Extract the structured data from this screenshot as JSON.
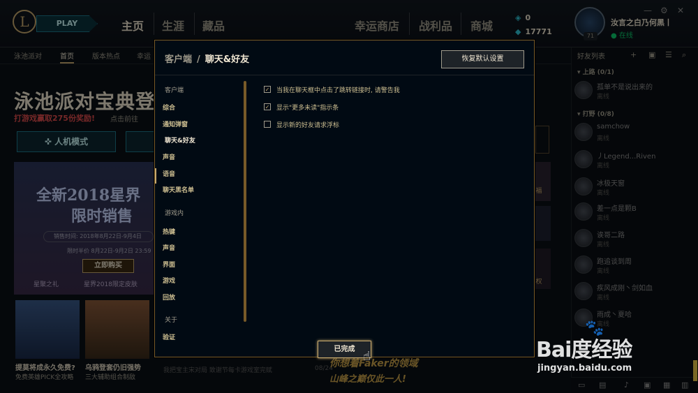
{
  "topbar": {
    "logo": "L",
    "play_label": "PLAY",
    "nav": [
      "主页",
      "生涯",
      "藏品",
      "幸运商店",
      "战利品",
      "商城"
    ],
    "currency": {
      "be": "0",
      "rp": "17771"
    },
    "currency_icons": [
      "blue-essence-icon",
      "riot-points-icon"
    ],
    "profile": {
      "name": "汝言之白乃何黑丨",
      "status": "在线",
      "level": "71"
    }
  },
  "subnav": [
    "泳池派对",
    "首页",
    "版本热点",
    "幸运"
  ],
  "background": {
    "headline": "泳池派对宝典登",
    "sub1": "打游戏赢取275份奖励!",
    "sub2": "点击前往",
    "btn1": "人机模式",
    "banner_title1": "全新2018星界",
    "banner_title2": "限时销售",
    "sale_time": "销售时间: 2018年8月22日-9月4日",
    "sale_time2": "限时半价 8月22日-9月2日 23:59",
    "buy": "立即购买",
    "tab1": "星聚之礼",
    "tab2": "星界2018限定皮肤",
    "cap1": "提莫将成永久免费?",
    "cap1b": "免费英雄PICK全攻略",
    "cap2": "乌鸦登套仍旧强势",
    "cap2b": "三大辅助组合制敌",
    "right_label1": "福",
    "right_label2": "权",
    "bottom_text": "我把宝主宋对局 致谢节每卡游戏室完赋",
    "bottom_date": "08/24",
    "bottom_banner1": "你想着Faker的领域",
    "bottom_banner2": "山峰之巅仅此一人!"
  },
  "friends": {
    "title": "好友列表",
    "groups": [
      {
        "label": "上路 (0/1)"
      },
      {
        "label": "打野 (0/8)"
      }
    ],
    "list": [
      {
        "name": "孤单不是说出来的",
        "status": "离线"
      },
      {
        "name": "samchow",
        "status": "离线"
      },
      {
        "name": "丿Legend...Riven",
        "status": "离线"
      },
      {
        "name": "冰极天窗",
        "status": "离线"
      },
      {
        "name": "差一点是颗B",
        "status": "离线"
      },
      {
        "name": "诶哥二路",
        "status": "离线"
      },
      {
        "name": "跑追谈到周",
        "status": "离线"
      },
      {
        "name": "疾风成刚丶剑如血",
        "status": "离线"
      },
      {
        "name": "雨成丶夏哈",
        "status": "离线"
      }
    ]
  },
  "modal": {
    "breadcrumb_root": "客户端",
    "breadcrumb_sep": "/",
    "breadcrumb_current": "聊天&好友",
    "reset_label": "恢复默认设置",
    "done_label": "已完成",
    "sections": [
      {
        "title": "客户端",
        "items": [
          "综合",
          "通知弹窗",
          "聊天&好友",
          "声音",
          "语音",
          "聊天黑名单"
        ]
      },
      {
        "title": "游戏内",
        "items": [
          "热键",
          "声音",
          "界面",
          "游戏",
          "回放"
        ]
      },
      {
        "title": "关于",
        "items": [
          "验证"
        ]
      }
    ],
    "active_item": "聊天&好友",
    "options": [
      {
        "label": "当我在聊天框中点击了跳转链接时, 请警告我",
        "checked": true
      },
      {
        "label": "显示\"更多未读\"指示条",
        "checked": true
      },
      {
        "label": "显示新的好友请求浮标",
        "checked": false
      }
    ],
    "check_glyph": "✓"
  },
  "watermark": {
    "text": "Bai度经验",
    "url": "jingyan.baidu.com"
  },
  "colors": {
    "gold": "#c8aa6e",
    "gold_dark": "#785a28",
    "teal": "#1e7a8c",
    "bg": "#010a13",
    "text": "#cdbe91"
  }
}
